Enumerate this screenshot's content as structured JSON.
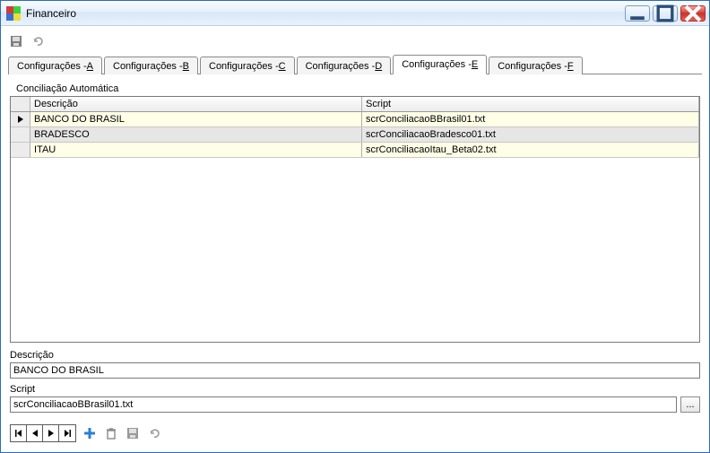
{
  "window": {
    "title": "Financeiro"
  },
  "tabs": [
    {
      "pre": "Configurações - ",
      "key": "A"
    },
    {
      "pre": "Configurações - ",
      "key": "B"
    },
    {
      "pre": "Configurações - ",
      "key": "C"
    },
    {
      "pre": "Configurações - ",
      "key": "D"
    },
    {
      "pre": "Configurações - ",
      "key": "E"
    },
    {
      "pre": "Configurações - ",
      "key": "F"
    }
  ],
  "group": {
    "legend": "Conciliação Automática"
  },
  "grid": {
    "headers": {
      "col1": "Descrição",
      "col2": "Script"
    },
    "rows": [
      {
        "descricao": "BANCO DO BRASIL",
        "script": "scrConciliacaoBBrasil01.txt"
      },
      {
        "descricao": "BRADESCO",
        "script": "scrConciliacaoBradesco01.txt"
      },
      {
        "descricao": "ITAU",
        "script": "scrConciliacaoItau_Beta02.txt"
      }
    ]
  },
  "fields": {
    "descricao": {
      "label": "Descrição",
      "value": "BANCO DO BRASIL"
    },
    "script": {
      "label": "Script",
      "value": "scrConciliacaoBBrasil01.txt"
    }
  },
  "browse_label": "...",
  "icons": {
    "save": "save-icon",
    "undo": "undo-icon",
    "first": "nav-first-icon",
    "prev": "nav-prev-icon",
    "next": "nav-next-icon",
    "last": "nav-last-icon",
    "add": "add-icon",
    "delete": "delete-icon",
    "save2": "save-icon",
    "undo2": "undo-icon"
  }
}
